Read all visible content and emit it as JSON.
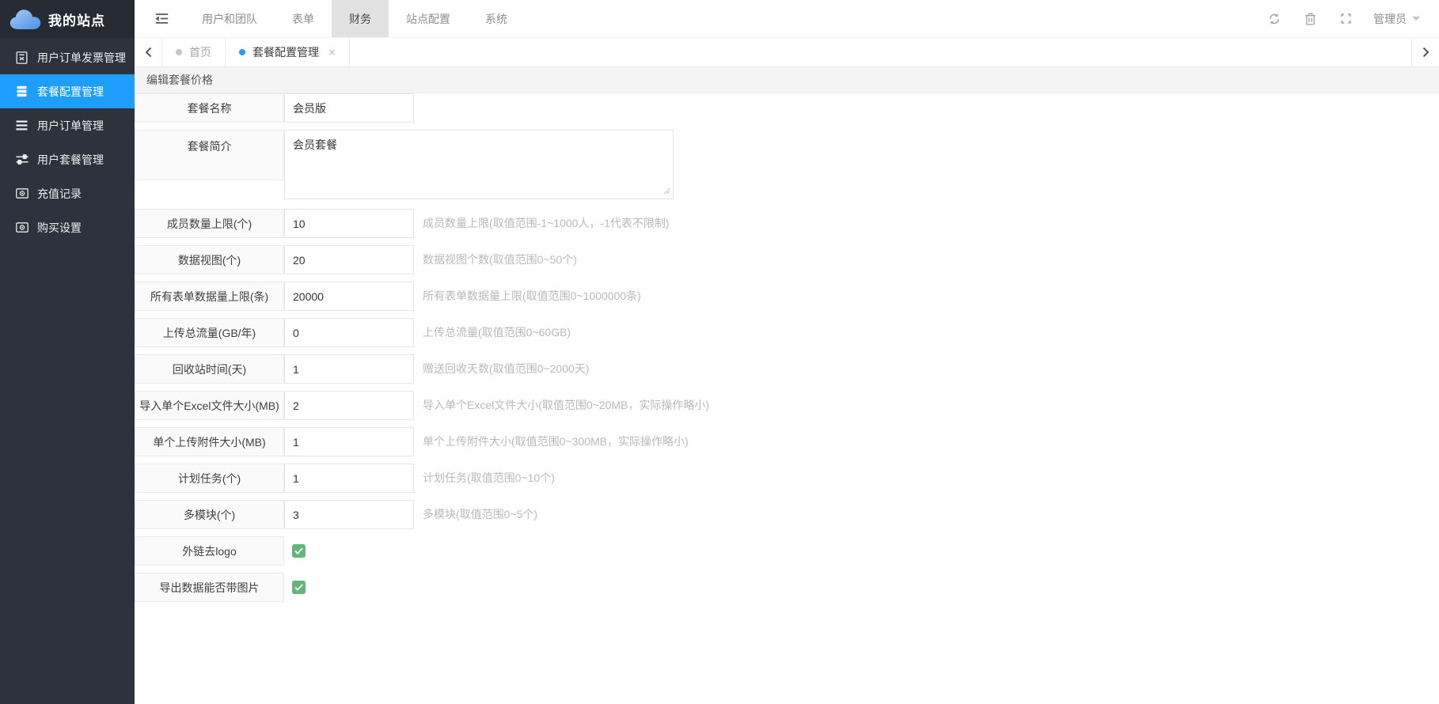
{
  "brand": {
    "name": "我的站点"
  },
  "topnav": {
    "items": [
      {
        "id": "users-teams",
        "label": "用户和团队",
        "active": false
      },
      {
        "id": "forms",
        "label": "表单",
        "active": false
      },
      {
        "id": "finance",
        "label": "财务",
        "active": true
      },
      {
        "id": "site-config",
        "label": "站点配置",
        "active": false
      },
      {
        "id": "system",
        "label": "系统",
        "active": false
      }
    ],
    "user_label": "管理员"
  },
  "sidebar": {
    "items": [
      {
        "id": "user-order-invoice",
        "label": "用户订单发票管理",
        "icon": "invoice-icon",
        "active": false
      },
      {
        "id": "package-config",
        "label": "套餐配置管理",
        "icon": "package-icon",
        "active": true
      },
      {
        "id": "user-orders",
        "label": "用户订单管理",
        "icon": "list-icon",
        "active": false
      },
      {
        "id": "user-packages",
        "label": "用户套餐管理",
        "icon": "sliders-icon",
        "active": false
      },
      {
        "id": "recharge-records",
        "label": "充值记录",
        "icon": "money-icon",
        "active": false
      },
      {
        "id": "purchase-settings",
        "label": "购买设置",
        "icon": "money-icon",
        "active": false
      }
    ]
  },
  "tabs": {
    "items": [
      {
        "id": "home",
        "label": "首页",
        "active": false,
        "closable": false
      },
      {
        "id": "package-config",
        "label": "套餐配置管理",
        "active": true,
        "closable": true
      }
    ],
    "close_glyph": "×"
  },
  "page": {
    "title": "编辑套餐价格"
  },
  "form": {
    "rows": [
      {
        "id": "package-name",
        "type": "text",
        "label": "套餐名称",
        "value": "会员版",
        "hint": ""
      },
      {
        "id": "package-intro",
        "type": "textarea",
        "label": "套餐简介",
        "value": "会员套餐",
        "hint": ""
      },
      {
        "id": "member-limit",
        "type": "text",
        "label": "成员数量上限(个)",
        "value": "10",
        "hint": "成员数量上限(取值范围-1~1000人，-1代表不限制)"
      },
      {
        "id": "data-views",
        "type": "text",
        "label": "数据视图(个)",
        "value": "20",
        "hint": "数据视图个数(取值范围0~50个)"
      },
      {
        "id": "form-data-limit",
        "type": "text",
        "label": "所有表单数据量上限(条)",
        "value": "20000",
        "hint": "所有表单数据量上限(取值范围0~1000000条)"
      },
      {
        "id": "upload-traffic",
        "type": "text",
        "label": "上传总流量(GB/年)",
        "value": "0",
        "hint": "上传总流量(取值范围0~60GB)"
      },
      {
        "id": "recycle-days",
        "type": "text",
        "label": "回收站时间(天)",
        "value": "1",
        "hint": "赠送回收天数(取值范围0~2000天)"
      },
      {
        "id": "excel-size",
        "type": "text",
        "label": "导入单个Excel文件大小(MB)",
        "value": "2",
        "hint": "导入单个Excel文件大小(取值范围0~20MB，实际操作略小)"
      },
      {
        "id": "attachment-size",
        "type": "text",
        "label": "单个上传附件大小(MB)",
        "value": "1",
        "hint": "单个上传附件大小(取值范围0~300MB，实际操作略小)"
      },
      {
        "id": "scheduled-tasks",
        "type": "text",
        "label": "计划任务(个)",
        "value": "1",
        "hint": "计划任务(取值范围0~10个)"
      },
      {
        "id": "multi-modules",
        "type": "text",
        "label": "多模块(个)",
        "value": "3",
        "hint": "多模块(取值范围0~5个)"
      },
      {
        "id": "remove-logo",
        "type": "checkbox",
        "label": "外链去logo",
        "checked": true,
        "hint": ""
      },
      {
        "id": "export-with-images",
        "type": "checkbox",
        "label": "导出数据能否带图片",
        "checked": true,
        "hint": ""
      }
    ]
  },
  "colors": {
    "accent": "#1e9fff",
    "checkbox_checked": "#5fb878",
    "sidebar_bg": "#2d323c"
  }
}
